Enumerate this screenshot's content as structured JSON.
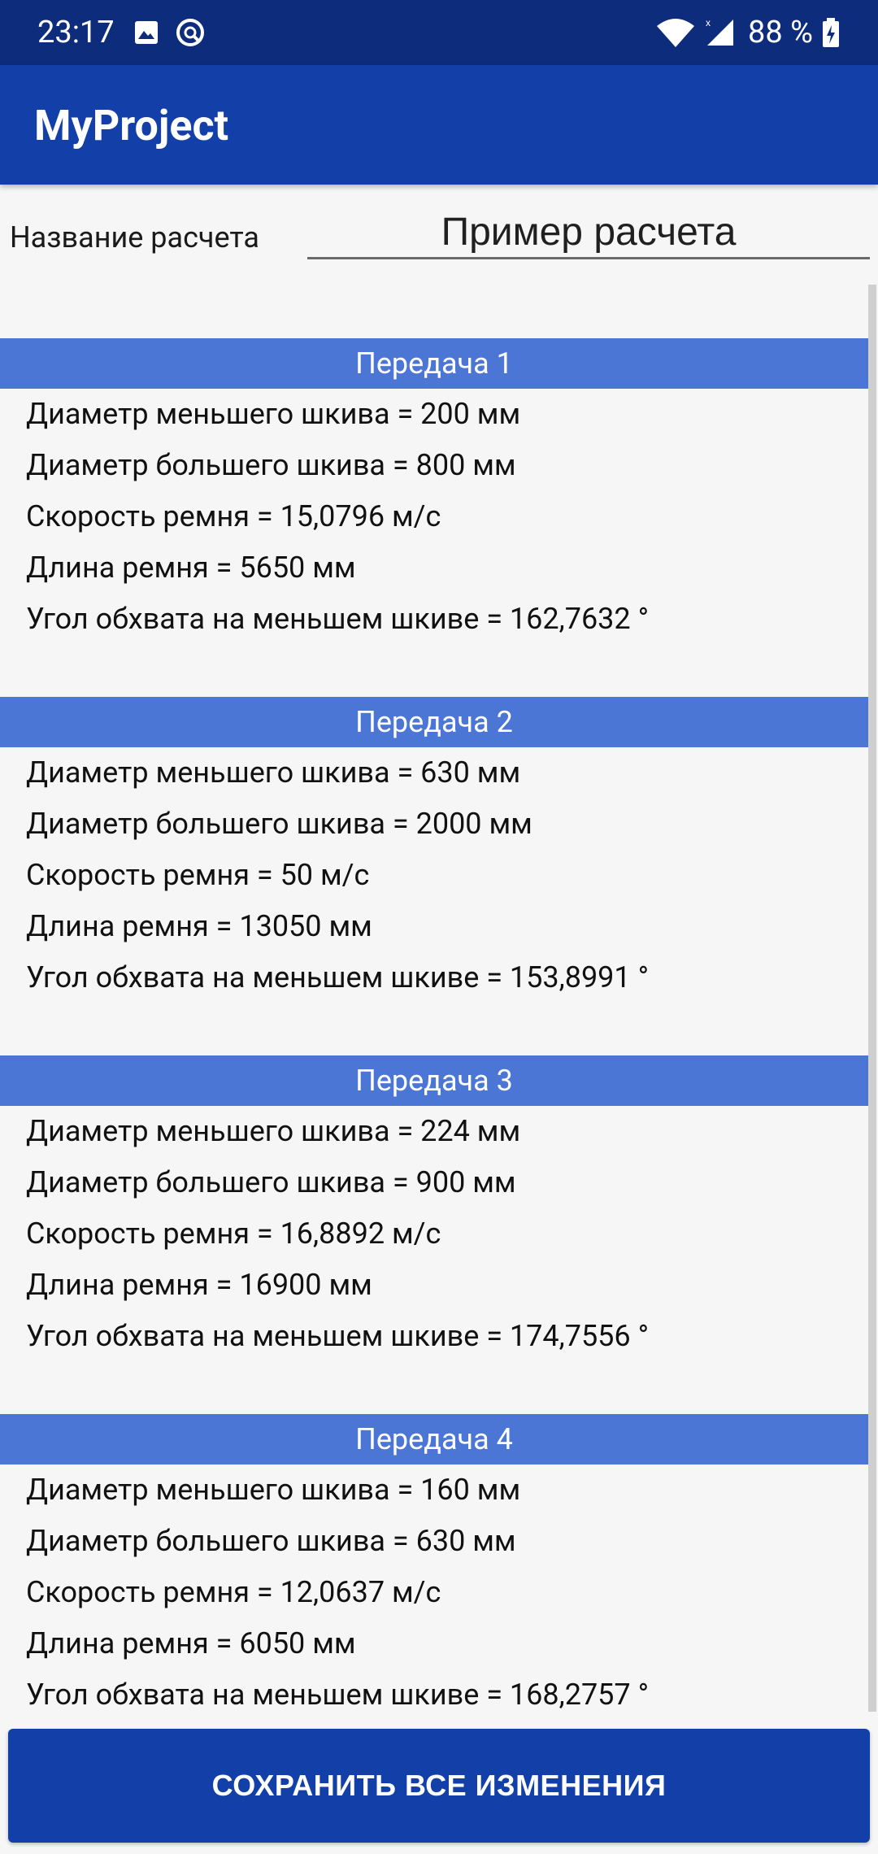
{
  "status_bar": {
    "time": "23:17",
    "battery": "88 %",
    "icons": [
      "image-icon",
      "sync-icon",
      "wifi-icon",
      "signal-icon",
      "battery-icon"
    ]
  },
  "app_bar": {
    "title": "MyProject"
  },
  "calc_name": {
    "label": "Название расчета",
    "value": "Пример расчета"
  },
  "gears": [
    {
      "title": "Передача 1",
      "rows": [
        "Диаметр меньшего шкива = 200 мм",
        "Диаметр большего шкива = 800 мм",
        "Скорость ремня = 15,0796 м/с",
        "Длина ремня = 5650 мм",
        "Угол обхвата на меньшем шкиве = 162,7632 °"
      ]
    },
    {
      "title": "Передача 2",
      "rows": [
        "Диаметр меньшего шкива = 630 мм",
        "Диаметр большего шкива = 2000 мм",
        "Скорость ремня = 50 м/с",
        "Длина ремня = 13050 мм",
        "Угол обхвата на меньшем шкиве = 153,8991 °"
      ]
    },
    {
      "title": "Передача 3",
      "rows": [
        "Диаметр меньшего шкива = 224 мм",
        "Диаметр большего шкива = 900 мм",
        "Скорость ремня = 16,8892 м/с",
        "Длина ремня = 16900 мм",
        "Угол обхвата на меньшем шкиве = 174,7556 °"
      ]
    },
    {
      "title": "Передача 4",
      "rows": [
        "Диаметр меньшего шкива = 160 мм",
        "Диаметр большего шкива = 630 мм",
        "Скорость ремня = 12,0637 м/с",
        "Длина ремня = 6050 мм",
        "Угол обхвата на меньшем шкиве = 168,2757 °"
      ]
    }
  ],
  "save_button": {
    "label": "СОХРАНИТЬ ВСЕ ИЗМЕНЕНИЯ"
  },
  "colors": {
    "status_bar": "#0d2d7c",
    "app_bar": "#1340a8",
    "section_header": "#4c76d6",
    "button": "#1340a8"
  }
}
